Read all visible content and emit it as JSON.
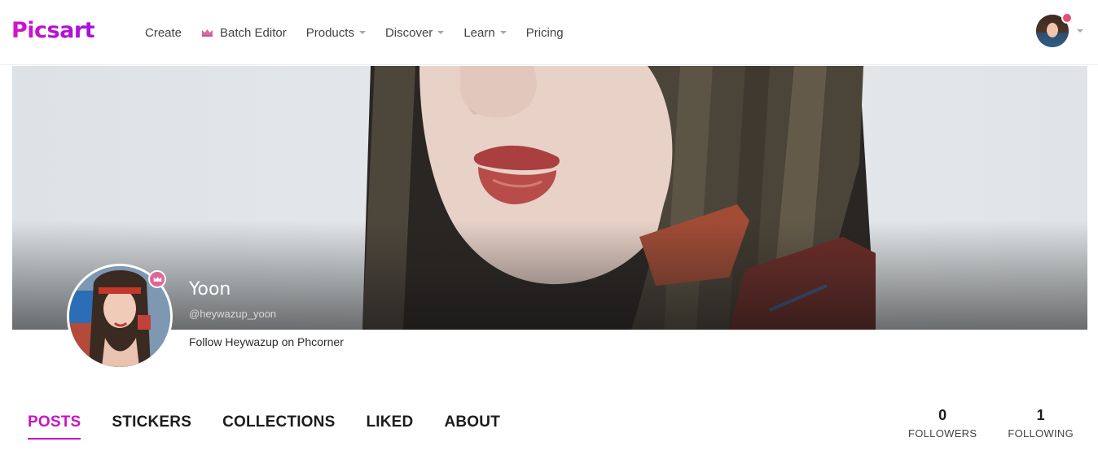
{
  "brand": {
    "logo_text": "Picsart",
    "accent": "#c716c3"
  },
  "nav": {
    "items": [
      {
        "label": "Create",
        "has_caret": false,
        "icon": ""
      },
      {
        "label": "Batch Editor",
        "has_caret": false,
        "icon": "crown-icon"
      },
      {
        "label": "Products",
        "has_caret": true,
        "icon": ""
      },
      {
        "label": "Discover",
        "has_caret": true,
        "icon": ""
      },
      {
        "label": "Learn",
        "has_caret": true,
        "icon": ""
      },
      {
        "label": "Pricing",
        "has_caret": false,
        "icon": ""
      }
    ]
  },
  "profile": {
    "name": "Yoon",
    "handle": "@heywazup_yoon",
    "bio": "Follow Heywazup on Phcorner"
  },
  "tabs": [
    {
      "label": "POSTS",
      "active": true
    },
    {
      "label": "STICKERS",
      "active": false
    },
    {
      "label": "COLLECTIONS",
      "active": false
    },
    {
      "label": "LIKED",
      "active": false
    },
    {
      "label": "ABOUT",
      "active": false
    }
  ],
  "stats": {
    "followers": {
      "count": "0",
      "label": "FOLLOWERS"
    },
    "following": {
      "count": "1",
      "label": "FOLLOWING"
    }
  }
}
